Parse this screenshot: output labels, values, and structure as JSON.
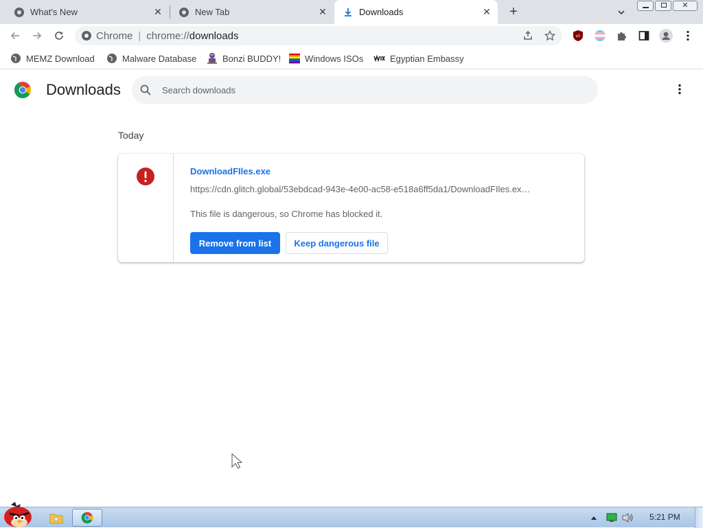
{
  "tabs": [
    {
      "title": "What's New",
      "icon": "chrome-globe-icon",
      "active": false
    },
    {
      "title": "New Tab",
      "icon": "chrome-globe-icon",
      "active": false
    },
    {
      "title": "Downloads",
      "icon": "download-icon",
      "active": true
    }
  ],
  "toolbar": {
    "site_label": "Chrome",
    "url_scheme": "chrome://",
    "url_path": "downloads"
  },
  "bookmarks": [
    {
      "label": "MEMZ Download",
      "icon": "globe-icon"
    },
    {
      "label": "Malware Database",
      "icon": "globe-icon"
    },
    {
      "label": "Bonzi BUDDY!",
      "icon": "bonzi-icon"
    },
    {
      "label": "Windows ISOs",
      "icon": "rainbow-flag-icon"
    },
    {
      "label": "Egyptian Embassy",
      "icon": "wix-icon"
    }
  ],
  "downloads_page": {
    "title": "Downloads",
    "search_placeholder": "Search downloads",
    "section_date": "Today",
    "item": {
      "file_name": "DownloadFIles.exe",
      "url": "https://cdn.glitch.global/53ebdcad-943e-4e00-ac58-e518a6ff5da1/DownloadFIles.ex…",
      "status": "This file is dangerous, so Chrome has blocked it.",
      "remove_label": "Remove from list",
      "keep_label": "Keep dangerous file"
    }
  },
  "taskbar": {
    "clock": "5:21 PM"
  },
  "colors": {
    "accent": "#1a73e8",
    "danger": "#c5221f",
    "tabstrip": "#dee1e6"
  }
}
